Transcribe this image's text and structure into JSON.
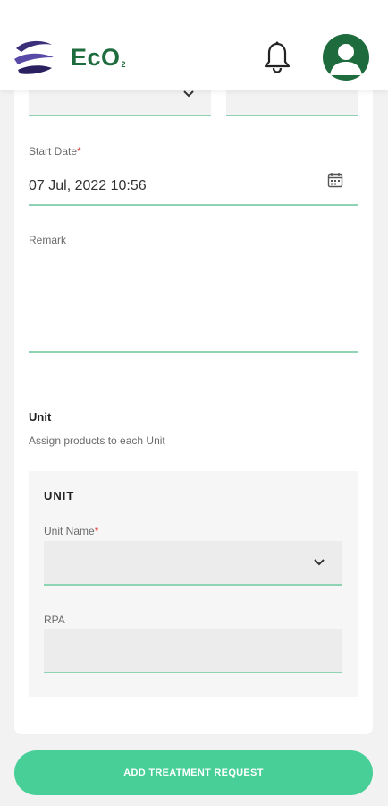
{
  "header": {
    "logo_text": "EcO",
    "logo_sub": "2"
  },
  "form": {
    "start_date": {
      "label": "Start Date",
      "required_mark": "*",
      "value": "07 Jul, 2022 10:56"
    },
    "remark": {
      "label": "Remark",
      "value": ""
    }
  },
  "unit_section": {
    "title": "Unit",
    "subtitle": "Assign products to each Unit",
    "card_title": "UNIT",
    "unit_name": {
      "label": "Unit Name",
      "required_mark": "*",
      "value": ""
    },
    "rpa": {
      "label": "RPA",
      "value": ""
    }
  },
  "actions": {
    "submit_label": "ADD TREATMENT REQUEST"
  },
  "colors": {
    "brand_green": "#1e6b3e",
    "accent": "#48cf98",
    "underline": "#8fd3b5",
    "required": "#e53935"
  },
  "icons": [
    "logo-mark-icon",
    "bell-icon",
    "avatar-icon",
    "chevron-down-icon",
    "calendar-icon"
  ]
}
